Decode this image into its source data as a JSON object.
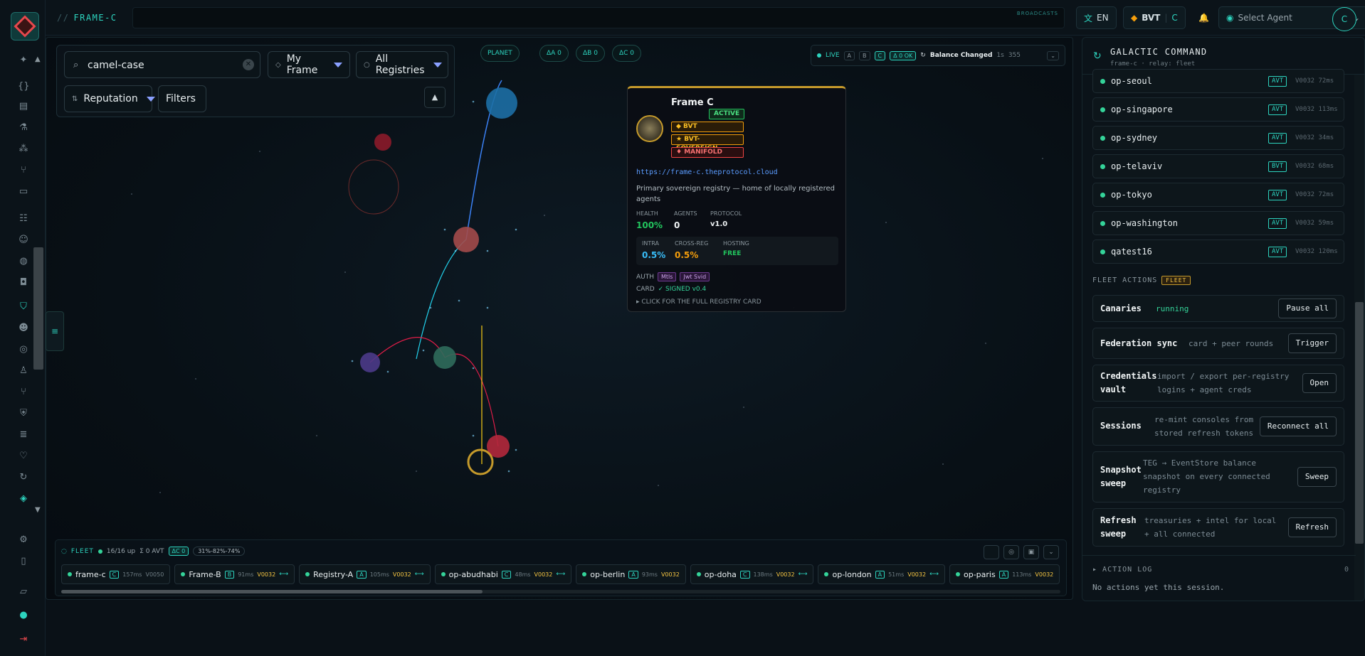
{
  "topbar": {
    "crumb_sep": "//",
    "crumb": "FRAME-C",
    "broadcasts": "BROADCASTS",
    "lang": "EN",
    "lang_icon": "translate-icon",
    "currency": "BVT",
    "currency_sub": "C",
    "agent_select": "Select Agent",
    "avatar": "C"
  },
  "search": {
    "value": "camel-case",
    "frame": "My Frame",
    "registries": "All Registries",
    "sort": "Reputation",
    "filters": "Filters"
  },
  "pills": [
    "PLANET",
    "ΔA 0",
    "ΔB 0",
    "ΔC 0"
  ],
  "live": {
    "label": "LIVE",
    "keys": [
      "A",
      "B",
      "C"
    ],
    "ok": "Δ 0 OK",
    "event": "Balance Changed",
    "event_meta": "1s",
    "count": "355"
  },
  "tooltip": {
    "title": "Frame C",
    "status": "ACTIVE",
    "tags": [
      "◆ BVT",
      "★ BVT-SOVEREIGN",
      "♦ MANIFOLD"
    ],
    "url": "https://frame-c.theprotocol.cloud",
    "description": "Primary sovereign registry — home of locally registered agents",
    "health_label": "HEALTH",
    "health": "100%",
    "agents_label": "AGENTS",
    "agents": "0",
    "protocol_label": "PROTOCOL",
    "protocol": "v1.0",
    "intra_label": "INTRA",
    "intra": "0.5%",
    "cross_label": "CROSS-REG",
    "cross": "0.5%",
    "hosting_label": "HOSTING",
    "hosting": "FREE",
    "auth_label": "AUTH",
    "auth": [
      "Mtls",
      "Jwt Svid"
    ],
    "card_label": "CARD",
    "card": "✓ SIGNED v0.4",
    "click": "▸ CLICK FOR THE FULL REGISTRY CARD"
  },
  "fleet": {
    "title": "FLEET",
    "up": "16/16 up",
    "avt": "Σ 0 AVT",
    "delta": "ΔC 0",
    "range": "31%-82%-74%",
    "items": [
      {
        "name": "frame-c",
        "badge": "C",
        "ms": "157ms",
        "v": "V0050",
        "gray": true
      },
      {
        "name": "Frame-B",
        "badge": "B",
        "ms": "91ms",
        "v": "V0032",
        "link": true
      },
      {
        "name": "Registry-A",
        "badge": "A",
        "ms": "105ms",
        "v": "V0032",
        "link": true
      },
      {
        "name": "op-abudhabi",
        "badge": "C",
        "ms": "48ms",
        "v": "V0032",
        "link": true
      },
      {
        "name": "op-berlin",
        "badge": "A",
        "ms": "93ms",
        "v": "V0032"
      },
      {
        "name": "op-doha",
        "badge": "C",
        "ms": "138ms",
        "v": "V0032",
        "link": true
      },
      {
        "name": "op-london",
        "badge": "A",
        "ms": "51ms",
        "v": "V0032",
        "link": true
      },
      {
        "name": "op-paris",
        "badge": "A",
        "ms": "113ms",
        "v": "V0032"
      }
    ]
  },
  "panel": {
    "title": "GALACTIC COMMAND",
    "subtitle": "frame-c · relay: fleet",
    "agents": [
      {
        "name": "op-seoul",
        "tag": "AVT",
        "v": "V0032",
        "ms": "72ms"
      },
      {
        "name": "op-singapore",
        "tag": "AVT",
        "v": "V0032",
        "ms": "113ms"
      },
      {
        "name": "op-sydney",
        "tag": "AVT",
        "v": "V0032",
        "ms": "34ms"
      },
      {
        "name": "op-telaviv",
        "tag": "BVT",
        "v": "V0032",
        "ms": "68ms"
      },
      {
        "name": "op-tokyo",
        "tag": "AVT",
        "v": "V0032",
        "ms": "72ms"
      },
      {
        "name": "op-washington",
        "tag": "AVT",
        "v": "V0032",
        "ms": "59ms"
      },
      {
        "name": "qatest16",
        "tag": "AVT",
        "v": "V0032",
        "ms": "120ms"
      }
    ],
    "fleet_actions": "FLEET ACTIONS",
    "fleet_chip": "FLEET",
    "canaries": "Canaries",
    "canaries_state": "running",
    "canaries_btn": "Pause all",
    "fed": "Federation sync",
    "fed_desc": "card + peer rounds",
    "fed_btn": "Trigger",
    "cred_1": "Credentials",
    "cred_2": "vault",
    "cred_desc_1": "import / export per-registry",
    "cred_desc_2": "logins + agent creds",
    "cred_btn": "Open",
    "sess": "Sessions",
    "sess_desc_1": "re-mint consoles from",
    "sess_desc_2": "stored refresh tokens",
    "sess_btn": "Reconnect all",
    "snap_1": "Snapshot",
    "snap_2": "sweep",
    "snap_desc_1": "TEG → EventStore balance",
    "snap_desc_2": "snapshot on every connected",
    "snap_desc_3": "registry",
    "snap_btn": "Sweep",
    "ref_1": "Refresh",
    "ref_2": "sweep",
    "ref_desc_1": "treasuries + intel for local",
    "ref_desc_2": "+ all connected",
    "ref_btn": "Refresh",
    "log_title": "ACTION LOG",
    "log_count": "0",
    "log_empty": "No actions yet this session."
  }
}
